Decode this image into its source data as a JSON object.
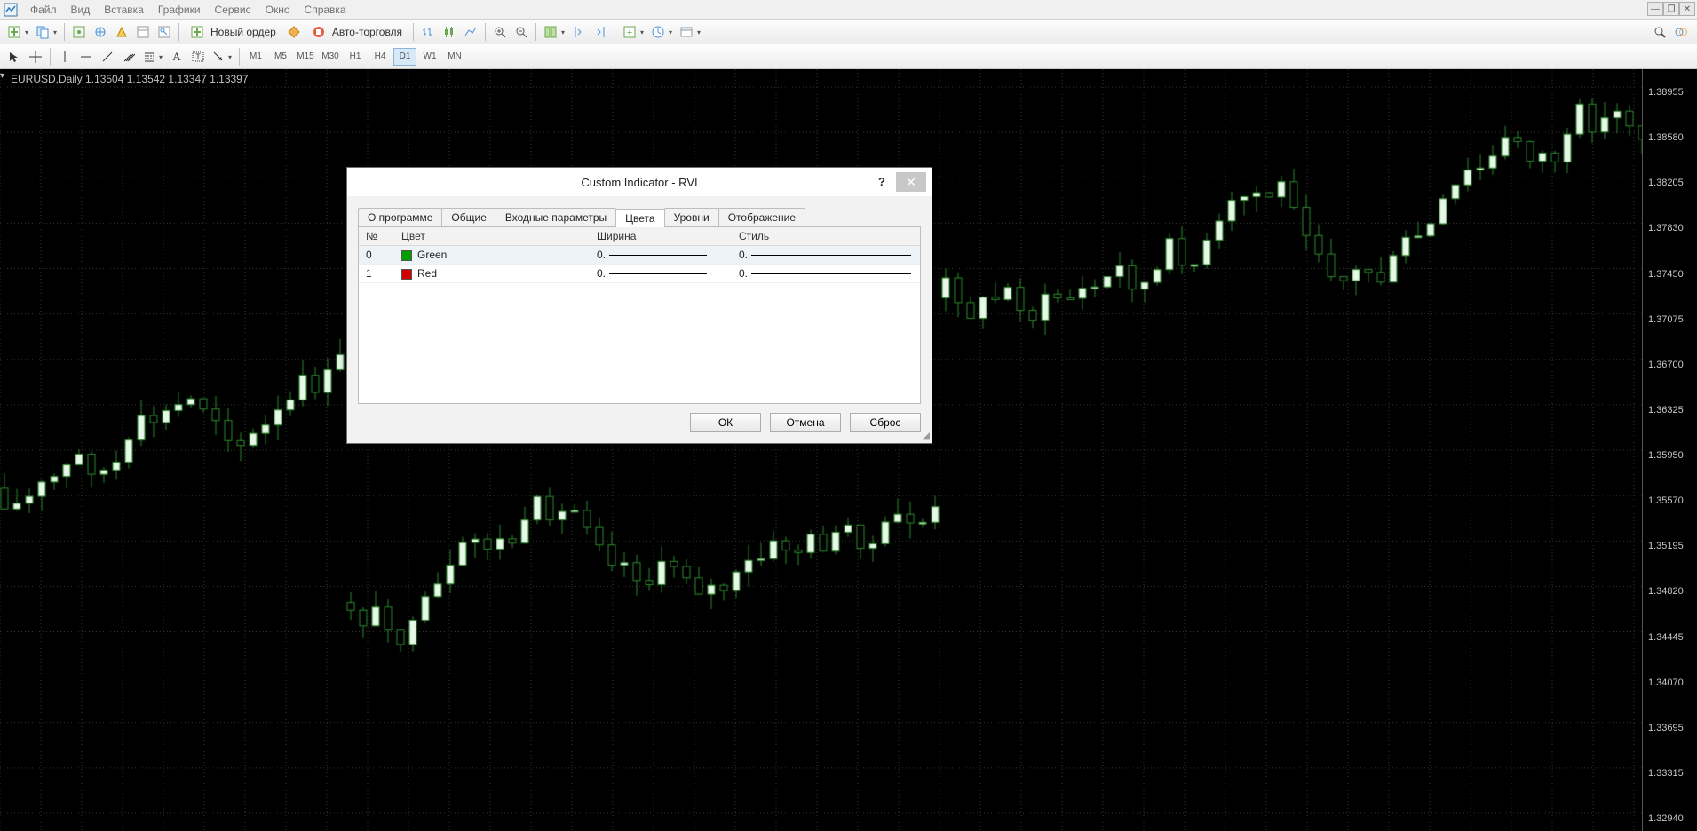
{
  "menu": {
    "items": [
      "Файл",
      "Вид",
      "Вставка",
      "Графики",
      "Сервис",
      "Окно",
      "Справка"
    ]
  },
  "toolbar1": {
    "new_order": "Новый ордер",
    "auto_trade": "Авто-торговля"
  },
  "toolbar2": {
    "timeframes": [
      "M1",
      "M5",
      "M15",
      "M30",
      "H1",
      "H4",
      "D1",
      "W1",
      "MN"
    ],
    "active_tf": "D1"
  },
  "chart": {
    "label": "EURUSD,Daily  1.13504 1.13542 1.13347 1.13397",
    "price_levels": [
      "1.38955",
      "1.38580",
      "1.38205",
      "1.37830",
      "1.37450",
      "1.37075",
      "1.36700",
      "1.36325",
      "1.35950",
      "1.35570",
      "1.35195",
      "1.34820",
      "1.34445",
      "1.34070",
      "1.33695",
      "1.33315",
      "1.32940"
    ]
  },
  "dialog": {
    "title": "Custom Indicator - RVI",
    "tabs": [
      "О программе",
      "Общие",
      "Входные параметры",
      "Цвета",
      "Уровни",
      "Отображение"
    ],
    "active_tab": "Цвета",
    "headers": {
      "num": "№",
      "color": "Цвет",
      "width": "Ширина",
      "style": "Стиль"
    },
    "rows": [
      {
        "n": "0",
        "color_name": "Green",
        "color_hex": "#00a000",
        "width": "0.",
        "style": "0."
      },
      {
        "n": "1",
        "color_name": "Red",
        "color_hex": "#d00000",
        "width": "0.",
        "style": "0."
      }
    ],
    "buttons": {
      "ok": "ОК",
      "cancel": "Отмена",
      "reset": "Сброс"
    }
  }
}
